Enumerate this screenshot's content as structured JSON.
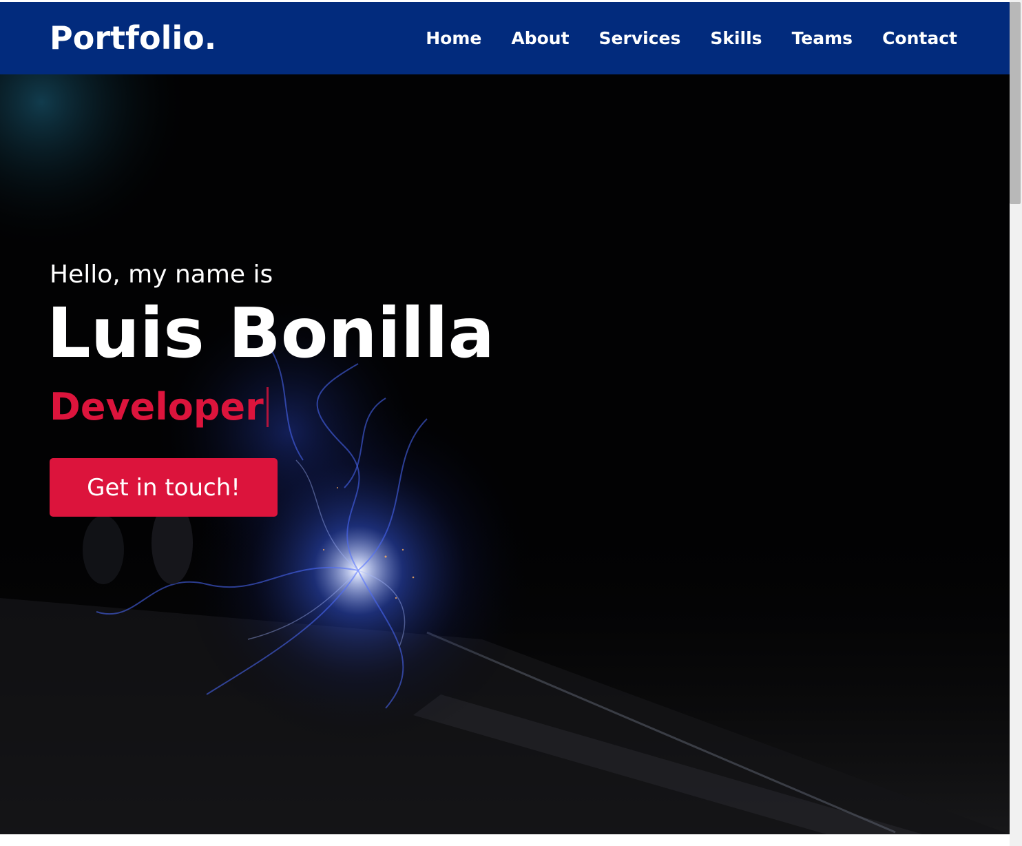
{
  "brand": {
    "logo": "Portfolio."
  },
  "nav": {
    "items": [
      {
        "label": "Home"
      },
      {
        "label": "About"
      },
      {
        "label": "Services"
      },
      {
        "label": "Skills"
      },
      {
        "label": "Teams"
      },
      {
        "label": "Contact"
      }
    ]
  },
  "hero": {
    "greeting": "Hello, my name is",
    "name": "Luis Bonilla",
    "role": "Developer",
    "cta_label": "Get in touch!"
  },
  "colors": {
    "navbar": "#022b7d",
    "accent": "#dc143c",
    "text": "#ffffff",
    "hero_bg": "#020203"
  },
  "icons": {
    "scrollbar": "scrollbar"
  }
}
